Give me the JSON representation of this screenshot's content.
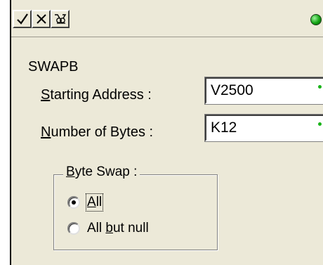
{
  "toolbar": {
    "ok_icon": "check-icon",
    "cancel_icon": "x-icon",
    "help_icon": "help-icon",
    "status_color": "#12a312"
  },
  "function_name": "SWAPB",
  "fields": [
    {
      "label_access": "S",
      "label_rest": "tarting Address :",
      "value": "V2500"
    },
    {
      "label_access": "N",
      "label_rest": "umber of Bytes :",
      "value": "K12"
    }
  ],
  "byte_swap": {
    "legend_access": "B",
    "legend_rest": "yte Swap :",
    "options": [
      {
        "access": "A",
        "rest": "ll",
        "pre": "",
        "selected": true
      },
      {
        "pre": "All ",
        "access": "b",
        "rest": "ut null",
        "selected": false
      }
    ]
  }
}
